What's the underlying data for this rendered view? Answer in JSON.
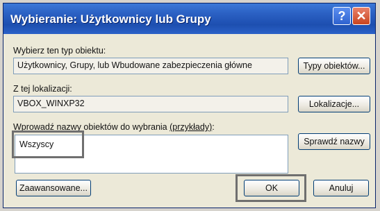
{
  "window": {
    "title": "Wybieranie: Użytkownicy lub Grupy",
    "help_glyph": "?",
    "close_glyph": "✕"
  },
  "object_type": {
    "label": "Wybierz ten typ obiektu:",
    "value": "Użytkownicy, Grupy, lub Wbudowane zabezpieczenia główne",
    "button": "Typy obiektów..."
  },
  "location": {
    "label": "Z tej lokalizacji:",
    "value": "VBOX_WINXP32",
    "button": "Lokalizacje..."
  },
  "names": {
    "label": "Wprowadź nazwy obiektów do wybrania",
    "examples_link": "(przykłady)",
    "label_suffix": ":",
    "value": "Wszyscy",
    "check_button": "Sprawdź nazwy"
  },
  "footer": {
    "advanced_button": "Zaawansowane...",
    "ok_button": "OK",
    "cancel_button": "Anuluj"
  }
}
